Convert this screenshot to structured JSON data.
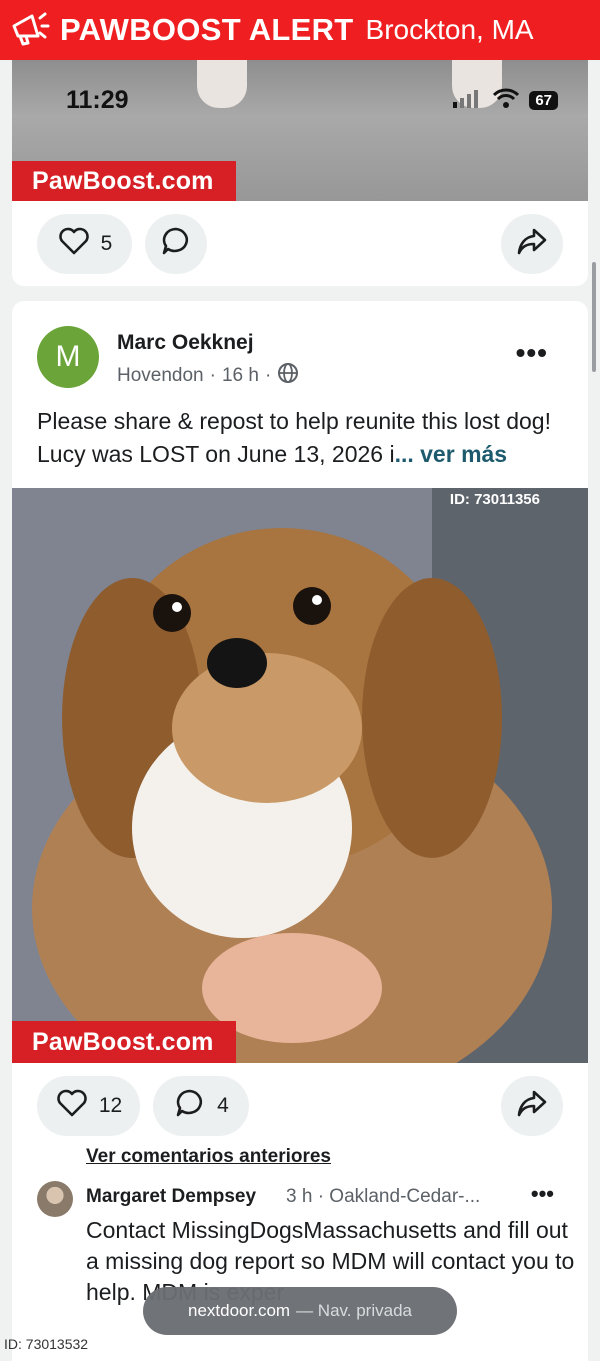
{
  "banner": {
    "brand": "PAWBOOST ALERT",
    "city": "Brockton, MA",
    "icon": "megaphone-icon",
    "color": "#ef1f21"
  },
  "status_bar": {
    "time": "11:29",
    "battery": "67"
  },
  "first_post": {
    "watermark": "PawBoost.com",
    "likes": "5"
  },
  "post": {
    "author": "Marc Oekknej",
    "avatar_letter": "M",
    "neighborhood": "Hovendon",
    "age": "16 h",
    "text": "Please share & repost to help reunite this lost dog! Lucy was LOST on June 13, 2026 i",
    "see_more": "... ver más",
    "photo_id": "ID: 73011356",
    "watermark": "PawBoost.com",
    "likes": "12",
    "comments": "4"
  },
  "comments": {
    "previous_link": "Ver comentarios anteriores",
    "items": [
      {
        "author": "Margaret Dempsey",
        "meta": "3 h · Oakland-Cedar-...",
        "text": "Contact MissingDogsMassachusetts and fill out a missing dog report so MDM will contact you to help. MDM is exper"
      }
    ]
  },
  "toast": {
    "site": "nextdoor.com",
    "mode": "— Nav. privada"
  },
  "footer_id": "ID: 73013532"
}
